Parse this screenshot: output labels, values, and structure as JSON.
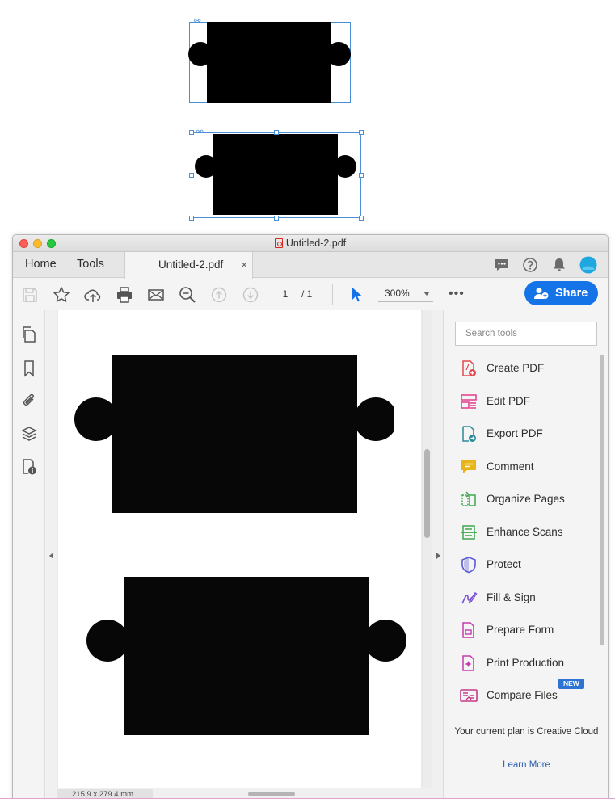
{
  "window": {
    "title": "Untitled-2.pdf"
  },
  "tabs": {
    "home": "Home",
    "tools": "Tools",
    "document": "Untitled-2.pdf",
    "close": "×"
  },
  "toolbar": {
    "page_current": "1",
    "page_total": "/ 1",
    "zoom": "300%",
    "more": "•••",
    "share_label": "Share"
  },
  "document": {
    "page_size": "215.9 x 279.4 mm"
  },
  "tools_panel": {
    "search_placeholder": "Search tools",
    "items": [
      {
        "label": "Create PDF",
        "icon": "create-pdf-icon",
        "color": "#e34850"
      },
      {
        "label": "Edit PDF",
        "icon": "edit-pdf-icon",
        "color": "#e03c8c"
      },
      {
        "label": "Export PDF",
        "icon": "export-pdf-icon",
        "color": "#2a8a9a"
      },
      {
        "label": "Comment",
        "icon": "comment-icon",
        "color": "#e8b418"
      },
      {
        "label": "Organize Pages",
        "icon": "organize-pages-icon",
        "color": "#3fa64e"
      },
      {
        "label": "Enhance Scans",
        "icon": "enhance-scans-icon",
        "color": "#3fa64e"
      },
      {
        "label": "Protect",
        "icon": "protect-icon",
        "color": "#5a5ad6"
      },
      {
        "label": "Fill & Sign",
        "icon": "fill-sign-icon",
        "color": "#7a4ed6"
      },
      {
        "label": "Prepare Form",
        "icon": "prepare-form-icon",
        "color": "#c33bb0"
      },
      {
        "label": "Print Production",
        "icon": "print-production-icon",
        "color": "#c33bb0"
      },
      {
        "label": "Compare Files",
        "icon": "compare-files-icon",
        "color": "#c33b8a",
        "badge": "NEW"
      }
    ],
    "plan_text": "Your current plan is Creative Cloud",
    "learn_more": "Learn More"
  },
  "colors": {
    "accent": "#1473e6",
    "selection": "#4a90d9"
  }
}
